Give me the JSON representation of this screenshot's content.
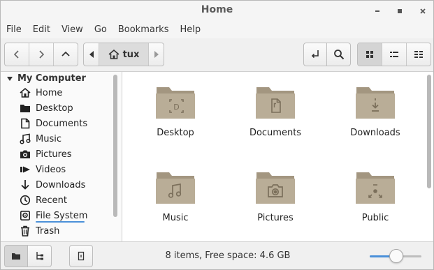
{
  "window": {
    "title": "Home"
  },
  "menu": [
    "File",
    "Edit",
    "View",
    "Go",
    "Bookmarks",
    "Help"
  ],
  "path": {
    "current": "tux"
  },
  "sidebar": {
    "header": "My Computer",
    "items": [
      {
        "label": "Home",
        "icon": "home-icon"
      },
      {
        "label": "Desktop",
        "icon": "desktop-folder-icon"
      },
      {
        "label": "Documents",
        "icon": "documents-icon"
      },
      {
        "label": "Music",
        "icon": "music-icon"
      },
      {
        "label": "Pictures",
        "icon": "camera-icon"
      },
      {
        "label": "Videos",
        "icon": "video-icon"
      },
      {
        "label": "Downloads",
        "icon": "download-icon"
      },
      {
        "label": "Recent",
        "icon": "clock-icon"
      },
      {
        "label": "File System",
        "icon": "drive-icon"
      },
      {
        "label": "Trash",
        "icon": "trash-icon"
      }
    ]
  },
  "folders": [
    {
      "label": "Desktop",
      "emblem": "desktop-emblem-icon"
    },
    {
      "label": "Documents",
      "emblem": "document-emblem-icon"
    },
    {
      "label": "Downloads",
      "emblem": "download-emblem-icon"
    },
    {
      "label": "Music",
      "emblem": "music-emblem-icon"
    },
    {
      "label": "Pictures",
      "emblem": "camera-emblem-icon"
    },
    {
      "label": "Public",
      "emblem": "share-emblem-icon"
    }
  ],
  "status": {
    "text": "8 items, Free space: 4.6 GB"
  },
  "zoom": {
    "level": 0.52
  },
  "colors": {
    "accent": "#4a90d9",
    "folder": "#b9ad97",
    "folder_dark": "#a39680"
  }
}
